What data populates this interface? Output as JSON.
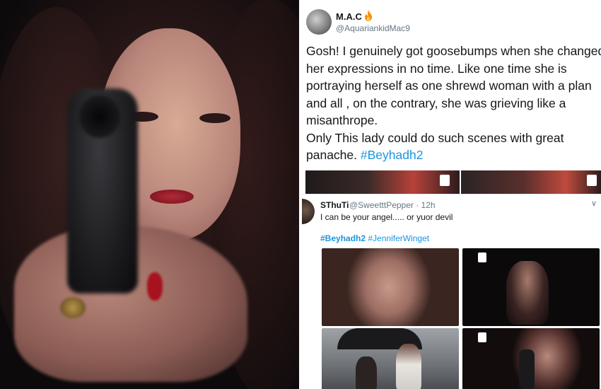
{
  "tweet": {
    "display_name": "M.A.C",
    "handle": "@AquariankidMac9",
    "text_lines": [
      "Gosh! I genuinely got goosebumps when she changed",
      "her expressions in no time. Like one time she is",
      "portraying herself as one shrewd woman with a plan",
      "and all , on the contrary, she was grieving like a",
      "misanthrope.",
      "Only This lady could do such scenes with great",
      "panache. "
    ],
    "hashtag": "#Beyhadh2"
  },
  "reply": {
    "display_name": "SThuTi",
    "handle_time": "@SweetttPepper · 12h",
    "chevron": "∨",
    "text": "I can be your angel..... or yuor devil",
    "hashtag_1": "#Beyhadh2",
    "hashtag_2": "#JenniferWinget"
  },
  "icons": [
    "fire-icon",
    "chevron-down-icon",
    "sony-logo-icon"
  ],
  "colors": {
    "link": "#1b95e0",
    "text": "#14171a",
    "muted": "#657786"
  }
}
